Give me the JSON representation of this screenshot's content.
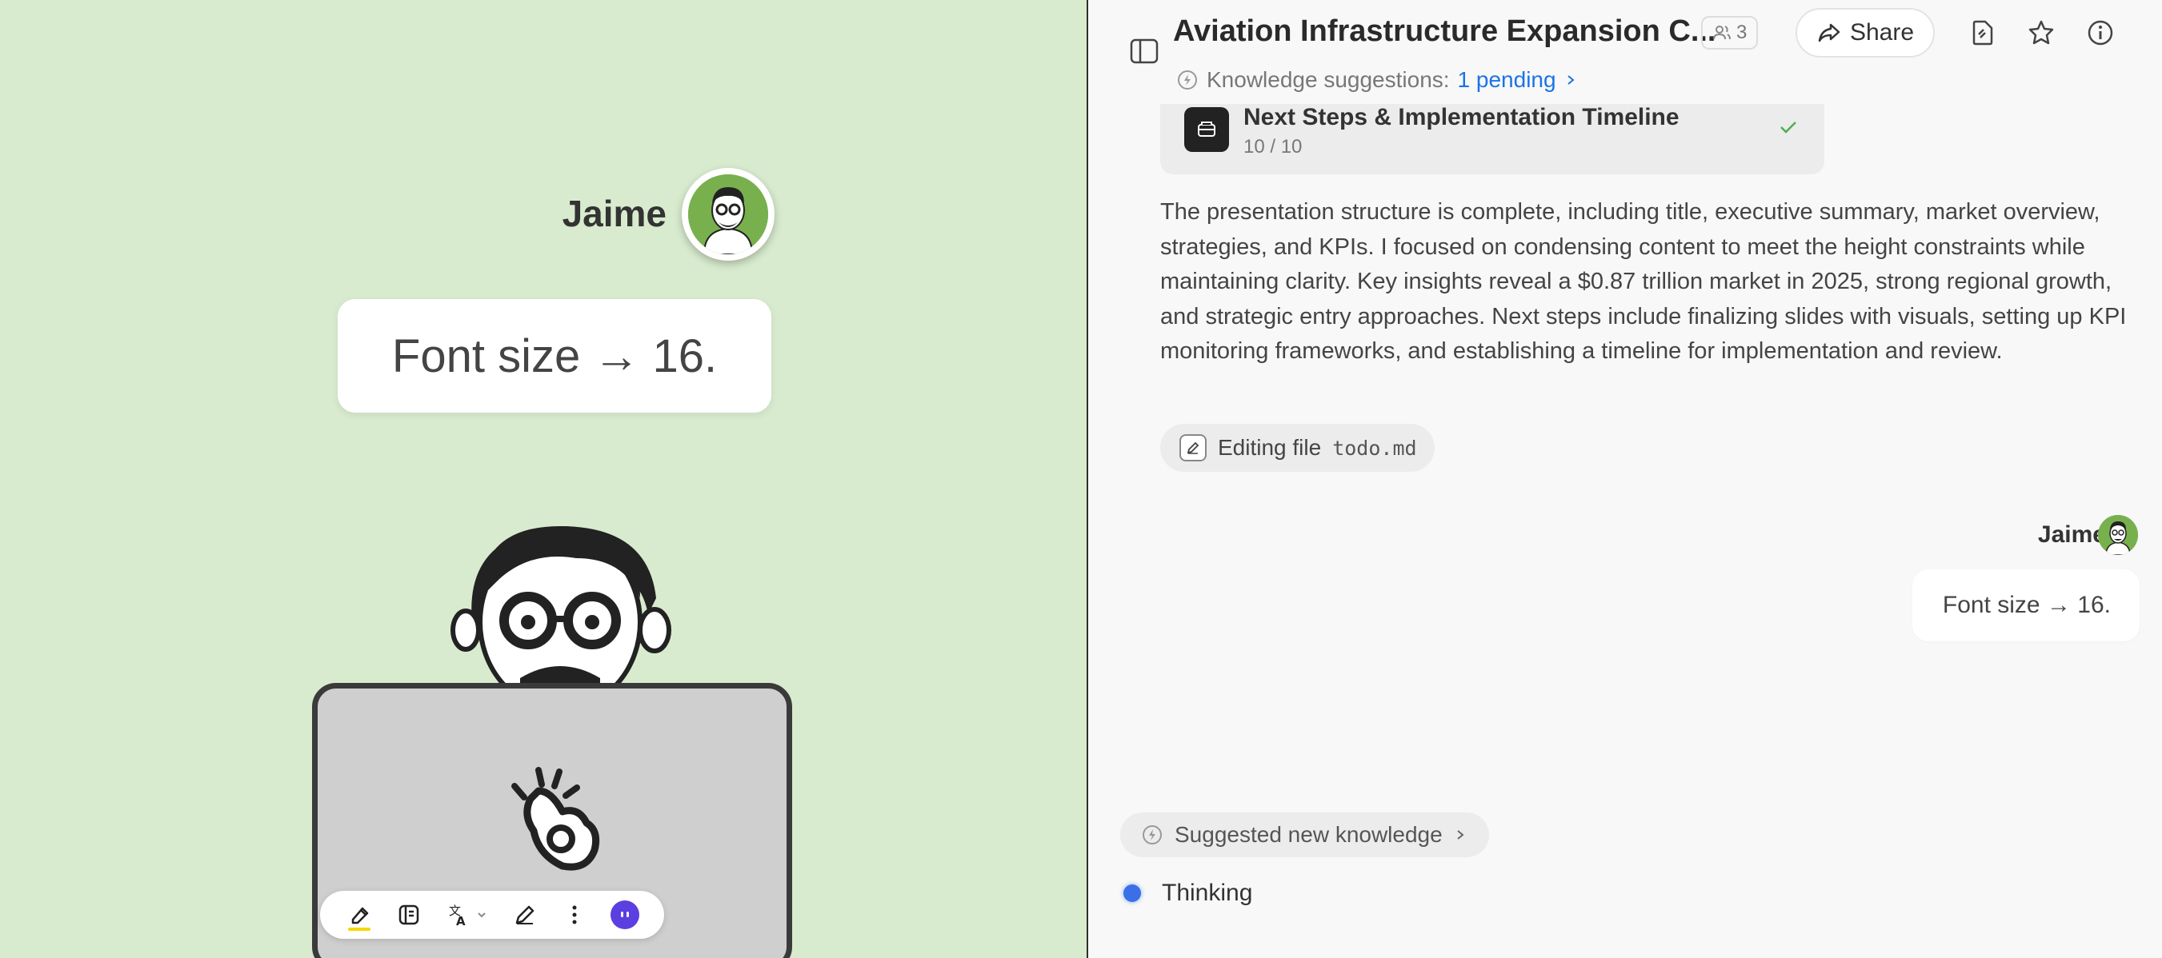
{
  "left_panel": {
    "user_name": "Jaime",
    "message": "Font size → 16.",
    "toolbar": {
      "icons": [
        "highlighter-icon",
        "panel-icon",
        "translate-icon",
        "pen-icon",
        "more-icon",
        "ai-assistant-icon"
      ]
    }
  },
  "header": {
    "title": "Aviation Infrastructure Expansion C...",
    "collaborators_count": "3",
    "share_label": "Share",
    "knowledge_label": "Knowledge suggestions:",
    "knowledge_pending": "1 pending"
  },
  "step_card": {
    "title": "Next Steps & Implementation Timeline",
    "progress": "10 / 10"
  },
  "assistant_message": "The presentation structure is complete, including title, executive summary, market overview, strategies, and KPIs. I focused on condensing content to meet the height constraints while maintaining clarity. Key insights reveal a $0.87 trillion market in 2025, strong regional growth, and strategic entry approaches. Next steps include finalizing slides with visuals, setting up KPI monitoring frameworks, and establishing a timeline for implementation and review.",
  "edit_chip": {
    "label": "Editing file",
    "filename": "todo.md"
  },
  "user_message": {
    "name": "Jaime",
    "text": "Font size → 16."
  },
  "suggested_knowledge": "Suggested new knowledge",
  "status": "Thinking",
  "colors": {
    "left_bg": "#d8ebce",
    "right_bg": "#f8f8f8",
    "accent_blue": "#1a73e8",
    "check_green": "#4caf50",
    "ai_purple": "#5b3fe0",
    "avatar_green": "#78b04e"
  }
}
